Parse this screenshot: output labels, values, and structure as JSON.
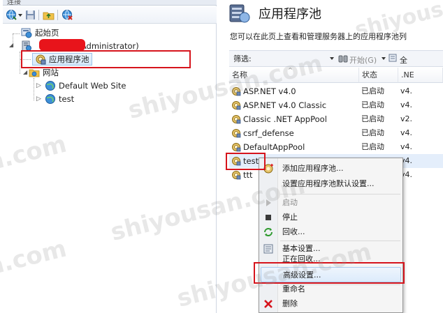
{
  "left_pane": {
    "title_strip": "连接",
    "tree": {
      "start_page": "起始页",
      "server_suffix": "\\Administrator)",
      "app_pools": "应用程序池",
      "sites": "网站",
      "site_items": [
        "Default Web Site",
        "test"
      ]
    }
  },
  "right_pane": {
    "title": "应用程序池",
    "description": "您可以在此页上查看和管理服务器上的应用程序池列",
    "filter_label": "筛选:",
    "start_label": "开始(G)",
    "all_label": "全",
    "columns": [
      "名称",
      "状态",
      ".NE"
    ],
    "rows": [
      {
        "name": "ASP.NET v4.0",
        "status": "已启动",
        "net": "v4."
      },
      {
        "name": "ASP.NET v4.0 Classic",
        "status": "已启动",
        "net": "v4."
      },
      {
        "name": "Classic .NET AppPool",
        "status": "已启动",
        "net": "v2."
      },
      {
        "name": "csrf_defense",
        "status": "已启动",
        "net": "v4."
      },
      {
        "name": "DefaultAppPool",
        "status": "已启动",
        "net": "v4."
      },
      {
        "name": "test",
        "status": "",
        "net": "v4."
      },
      {
        "name": "ttt",
        "status": "",
        "net": "v4."
      }
    ]
  },
  "context_menu": {
    "items": [
      {
        "label": "添加应用程序池...",
        "icon": "add-pool-icon"
      },
      {
        "label": "设置应用程序池默认设置...",
        "icon": ""
      },
      {
        "label": "启动",
        "icon": "play-icon",
        "disabled": true
      },
      {
        "label": "停止",
        "icon": "stop-icon"
      },
      {
        "label": "回收...",
        "icon": "recycle-icon"
      },
      {
        "label": "基本设置...",
        "icon": "settings-icon"
      },
      {
        "label": "正在回收...",
        "icon": ""
      },
      {
        "label": "高级设置...",
        "icon": ""
      },
      {
        "label": "重命名",
        "icon": ""
      },
      {
        "label": "删除",
        "icon": "delete-icon"
      }
    ]
  },
  "watermark": {
    "text_a": "shiyousan.com",
    "text_b": "n.com"
  },
  "colors": {
    "annotation_red": "#d6141c",
    "selection_blue": "#9cc3ea"
  }
}
